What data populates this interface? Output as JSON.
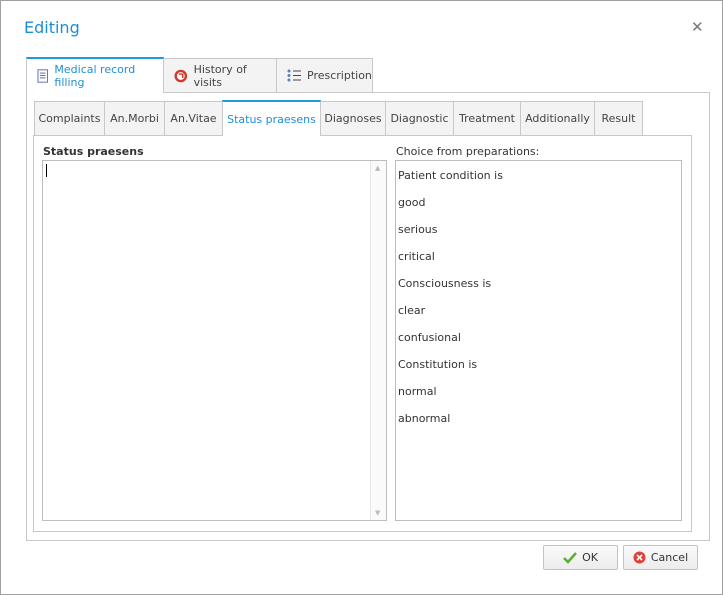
{
  "window": {
    "title": "Editing",
    "close_icon": "close-icon"
  },
  "outer_tabs": [
    {
      "label": "Medical record filling",
      "icon": "document-icon",
      "active": true
    },
    {
      "label": "History of visits",
      "icon": "history-icon",
      "active": false
    },
    {
      "label": "Prescription",
      "icon": "list-icon",
      "active": false
    }
  ],
  "inner_tabs": [
    {
      "label": "Complaints"
    },
    {
      "label": "An.Morbi"
    },
    {
      "label": "An.Vitae"
    },
    {
      "label": "Status praesens",
      "active": true
    },
    {
      "label": "Diagnoses"
    },
    {
      "label": "Diagnostic"
    },
    {
      "label": "Treatment"
    },
    {
      "label": "Additionally"
    },
    {
      "label": "Result"
    }
  ],
  "editor": {
    "label": "Status praesens",
    "value": ""
  },
  "preparations": {
    "label": "Choice from preparations:",
    "items": [
      "Patient condition is",
      "good",
      "serious",
      "critical",
      "Consciousness is",
      "clear",
      "confusional",
      "Constitution is",
      "normal",
      "abnormal"
    ]
  },
  "buttons": {
    "ok": "OK",
    "cancel": "Cancel"
  },
  "colors": {
    "accent": "#1e9be0",
    "title": "#1e8ed6"
  }
}
